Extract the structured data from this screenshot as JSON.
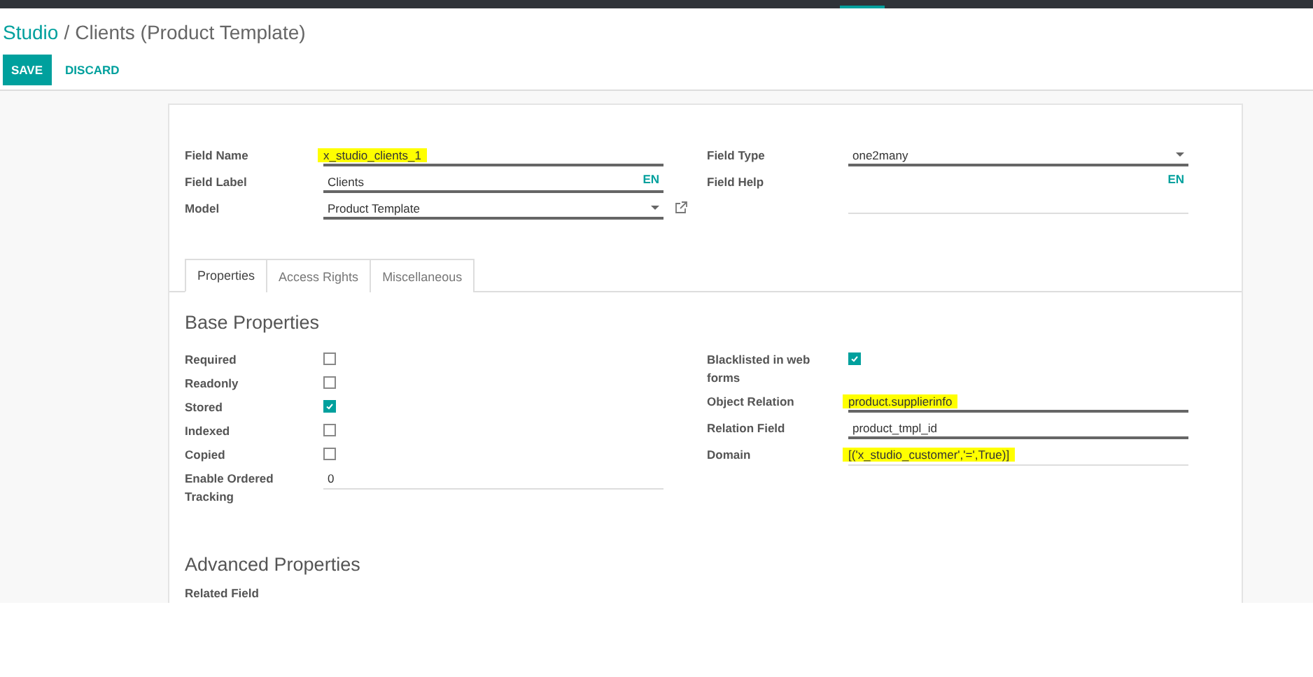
{
  "top_bar": {
    "active_indicator": true
  },
  "breadcrumb": [
    {
      "label": "Studio",
      "kind": "link"
    },
    {
      "label": "/",
      "kind": "separator"
    },
    {
      "label": "Clients (Product Template)",
      "kind": "current"
    }
  ],
  "buttons": [
    {
      "label": "SAVE",
      "kind": "primary"
    },
    {
      "label": "DISCARD",
      "kind": "link"
    }
  ],
  "left_fields": [
    {
      "label": "Field Name",
      "value": "x_studio_clients_1",
      "kind": "text",
      "required": true,
      "highlighted": true
    },
    {
      "label": "Field Label",
      "value": "Clients",
      "kind": "text",
      "required": true,
      "lang": "EN"
    },
    {
      "label": "Model",
      "value": "Product Template",
      "kind": "select",
      "required": true,
      "external_link": true
    }
  ],
  "right_fields": [
    {
      "label": "Field Type",
      "value": "one2many",
      "kind": "select",
      "required": true
    },
    {
      "label": "Field Help",
      "kind": "textarea",
      "required": false,
      "lang": "EN"
    }
  ],
  "tabs": [
    {
      "label": "Properties",
      "selected": true
    },
    {
      "label": "Access Rights",
      "selected": false
    },
    {
      "label": "Miscellaneous",
      "selected": false
    }
  ],
  "base_properties": {
    "title": "Base Properties",
    "left": [
      {
        "label": "Required",
        "kind": "checkbox",
        "checked": false
      },
      {
        "label": "Readonly",
        "kind": "checkbox",
        "checked": false
      },
      {
        "label": "Stored",
        "kind": "checkbox",
        "checked": true
      },
      {
        "label": "Indexed",
        "kind": "checkbox",
        "checked": false
      },
      {
        "label": "Copied",
        "kind": "checkbox",
        "checked": false
      },
      {
        "label": "Enable Ordered Tracking",
        "kind": "text",
        "value": "0",
        "required": false
      }
    ],
    "right": [
      {
        "label": "Blacklisted in web forms",
        "kind": "checkbox",
        "checked": true
      },
      {
        "label": "Object Relation",
        "kind": "text",
        "value": "product.supplierinfo",
        "required": true,
        "highlighted": true
      },
      {
        "label": "Relation Field",
        "kind": "text",
        "value": "product_tmpl_id",
        "required": true
      },
      {
        "label": "Domain",
        "kind": "text",
        "value": "[('x_studio_customer','=',True)]",
        "required": false,
        "highlighted": true
      }
    ]
  },
  "advanced_properties": {
    "title": "Advanced Properties",
    "fields": [
      {
        "label": "Related Field"
      }
    ]
  }
}
